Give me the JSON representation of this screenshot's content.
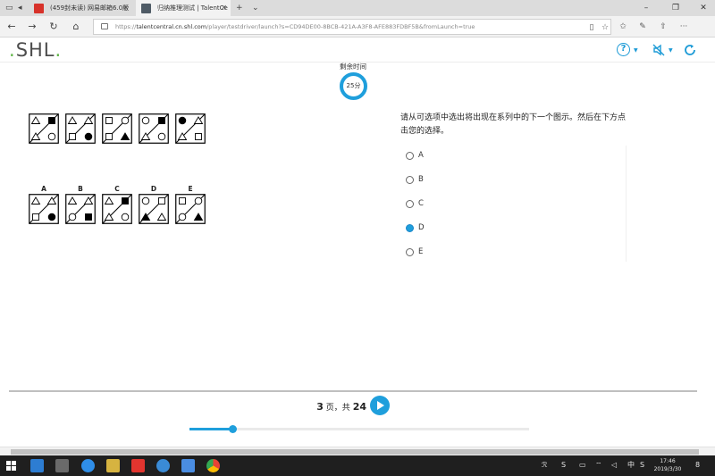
{
  "browser": {
    "tabs": [
      {
        "label": "(459封未读) 网易邮箱6.0版"
      },
      {
        "label": "归纳推理测试 | TalentCe"
      }
    ],
    "url_prefix": "https://",
    "url_domain": "talentcentral.cn.shl.com",
    "url_rest": "/player/testdriver/launch?s=CD94DE00-8BCB-421A-A3F8-AFE883FDBF5B&fromLaunch=true"
  },
  "header": {
    "logo": "SHL",
    "logo_dot": ".",
    "help_label": "?"
  },
  "timer": {
    "label": "剩余时间",
    "value": "25分"
  },
  "question": {
    "text": "请从可选项中选出将出现在系列中的下一个图示。然后在下方点击您的选择。",
    "options": [
      {
        "label": "A",
        "selected": false
      },
      {
        "label": "B",
        "selected": false
      },
      {
        "label": "C",
        "selected": false
      },
      {
        "label": "D",
        "selected": true
      },
      {
        "label": "E",
        "selected": false
      }
    ]
  },
  "sequence_boxes": [
    {
      "tl": "tri-open",
      "tr": "square-filled",
      "bl": "tri-open",
      "br": "circle-open"
    },
    {
      "tl": "tri-open",
      "tr": "tri-open",
      "bl": "square-open",
      "br": "circle-filled"
    },
    {
      "tl": "square-open",
      "tr": "circle-open",
      "bl": "square-open",
      "br": "tri-filled"
    },
    {
      "tl": "circle-open",
      "tr": "square-filled",
      "bl": "tri-open",
      "br": "circle-open"
    },
    {
      "tl": "circle-filled",
      "tr": "tri-open",
      "bl": "tri-open",
      "br": "square-open"
    }
  ],
  "answer_boxes": [
    {
      "letter": "A",
      "tl": "tri-open",
      "tr": "tri-open",
      "bl": "square-open",
      "br": "circle-filled"
    },
    {
      "letter": "B",
      "tl": "tri-open",
      "tr": "tri-open",
      "bl": "circle-open",
      "br": "square-filled"
    },
    {
      "letter": "C",
      "tl": "tri-open",
      "tr": "square-filled",
      "bl": "tri-open",
      "br": "circle-open"
    },
    {
      "letter": "D",
      "tl": "circle-open",
      "tr": "square-open",
      "bl": "tri-filled",
      "br": "tri-open"
    },
    {
      "letter": "E",
      "tl": "square-open",
      "tr": "circle-open",
      "bl": "circle-open",
      "br": "tri-filled"
    }
  ],
  "pager": {
    "current": "3",
    "mid_text": "页，共",
    "total": "24"
  },
  "progress": {
    "fraction": 0.125
  },
  "taskbar": {
    "ime": "中",
    "time": "17:46",
    "date": "2019/3/30",
    "notif_count": "8"
  },
  "colors": {
    "accent": "#1f9fdc",
    "logo_green": "#5fb446"
  }
}
